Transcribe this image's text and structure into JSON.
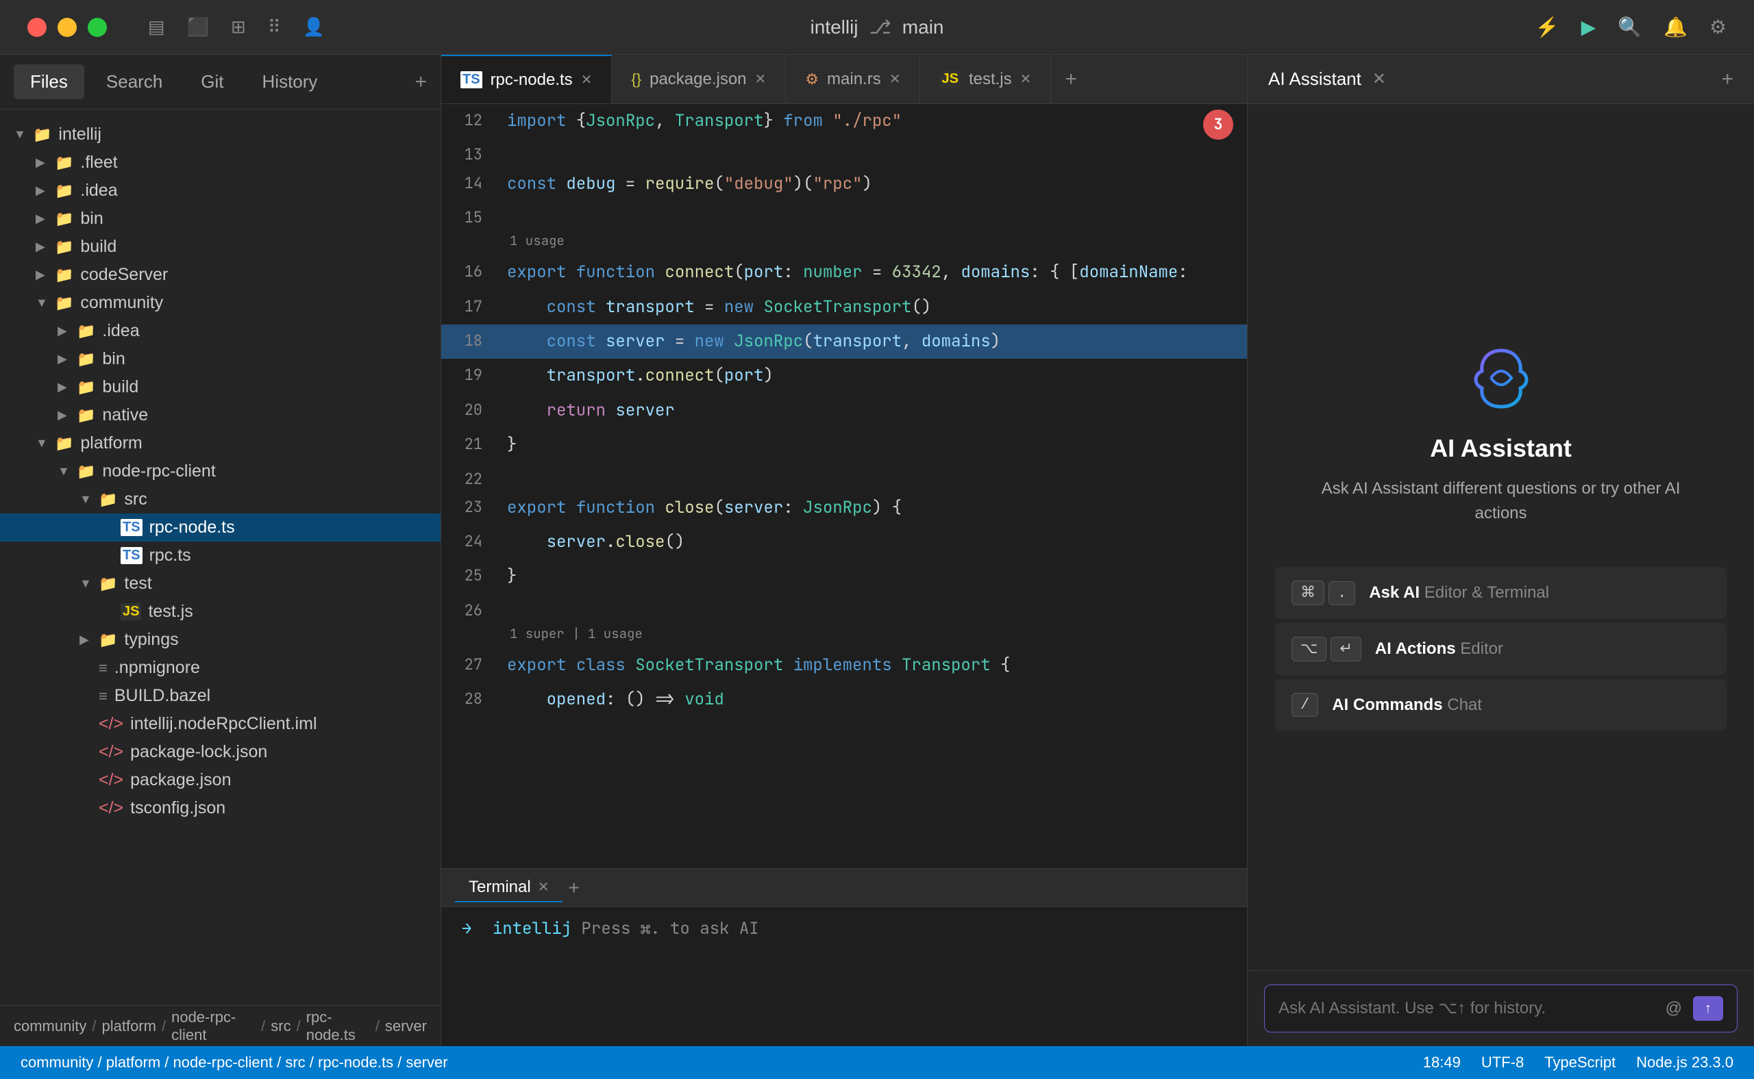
{
  "titlebar": {
    "app_name": "intellij",
    "branch": "main",
    "icons": [
      "sidebar-left",
      "sidebar-bottom",
      "layout",
      "grid",
      "people"
    ]
  },
  "sidebar": {
    "tabs": [
      "Files",
      "Search",
      "Git",
      "History"
    ],
    "active_tab": "Files",
    "root_label": "intellij",
    "tree": [
      {
        "label": ".fleet",
        "type": "folder",
        "depth": 0,
        "collapsed": true
      },
      {
        "label": ".idea",
        "type": "folder",
        "depth": 0,
        "collapsed": true
      },
      {
        "label": "bin",
        "type": "folder",
        "depth": 0,
        "collapsed": true
      },
      {
        "label": "build",
        "type": "folder",
        "depth": 0,
        "collapsed": true
      },
      {
        "label": "codeServer",
        "type": "folder",
        "depth": 0,
        "collapsed": true
      },
      {
        "label": "community",
        "type": "folder",
        "depth": 0,
        "expanded": true
      },
      {
        "label": ".idea",
        "type": "folder",
        "depth": 1,
        "collapsed": true
      },
      {
        "label": "bin",
        "type": "folder",
        "depth": 1,
        "collapsed": true
      },
      {
        "label": "build",
        "type": "folder",
        "depth": 1,
        "collapsed": true
      },
      {
        "label": "native",
        "type": "folder",
        "depth": 1,
        "collapsed": true
      },
      {
        "label": "platform",
        "type": "folder",
        "depth": 0,
        "expanded": true
      },
      {
        "label": "node-rpc-client",
        "type": "folder",
        "depth": 1,
        "expanded": true
      },
      {
        "label": "src",
        "type": "folder",
        "depth": 2,
        "expanded": true
      },
      {
        "label": "rpc-node.ts",
        "type": "ts",
        "depth": 3,
        "selected": true
      },
      {
        "label": "rpc.ts",
        "type": "ts",
        "depth": 3
      },
      {
        "label": "test",
        "type": "folder",
        "depth": 2,
        "expanded": true
      },
      {
        "label": "test.js",
        "type": "js",
        "depth": 3
      },
      {
        "label": "typings",
        "type": "folder",
        "depth": 2,
        "collapsed": true
      },
      {
        "label": ".npmignore",
        "type": "file",
        "depth": 2
      },
      {
        "label": "BUILD.bazel",
        "type": "file",
        "depth": 2
      },
      {
        "label": "intellij.nodeRpcClient.iml",
        "type": "xml",
        "depth": 2
      },
      {
        "label": "package-lock.json",
        "type": "json",
        "depth": 2
      },
      {
        "label": "package.json",
        "type": "json",
        "depth": 2
      },
      {
        "label": "tsconfig.json",
        "type": "json",
        "depth": 2
      }
    ],
    "footer_breadcrumb": [
      "community",
      "platform",
      "node-rpc-client",
      "src",
      "rpc-node.ts",
      "server"
    ]
  },
  "editor": {
    "tabs": [
      {
        "label": "rpc-node.ts",
        "type": "ts",
        "active": true
      },
      {
        "label": "package.json",
        "type": "json",
        "active": false
      },
      {
        "label": "main.rs",
        "type": "rs",
        "active": false
      },
      {
        "label": "test.js",
        "type": "js",
        "active": false
      }
    ],
    "badge_count": "3",
    "lines": [
      {
        "num": "12",
        "meta": "",
        "content": "import {JsonRpc, Transport} from \"./rpc\""
      },
      {
        "num": "13",
        "meta": "",
        "content": ""
      },
      {
        "num": "14",
        "meta": "",
        "content": "const debug = require(\"debug\")(\"rpc\")"
      },
      {
        "num": "15",
        "meta": "",
        "content": ""
      },
      {
        "num": "16",
        "meta": "1 usage",
        "content": "export function connect(port: number = 63342, domains: { [domainName:"
      },
      {
        "num": "17",
        "meta": "",
        "content": "  const transport = new SocketTransport()"
      },
      {
        "num": "18",
        "meta": "",
        "content": "  const server = new JsonRpc(transport, domains)",
        "highlighted": true
      },
      {
        "num": "19",
        "meta": "",
        "content": "  transport.connect(port)"
      },
      {
        "num": "20",
        "meta": "",
        "content": "  return server"
      },
      {
        "num": "21",
        "meta": "",
        "content": "}"
      },
      {
        "num": "22",
        "meta": "",
        "content": ""
      },
      {
        "num": "23",
        "meta": "",
        "content": "export function close(server: JsonRpc) {"
      },
      {
        "num": "24",
        "meta": "",
        "content": "  server.close()"
      },
      {
        "num": "25",
        "meta": "",
        "content": "}"
      },
      {
        "num": "26",
        "meta": "",
        "content": ""
      },
      {
        "num": "27",
        "meta": "1 super | 1 usage",
        "content": "export class SocketTransport implements Transport {"
      },
      {
        "num": "28",
        "meta": "",
        "content": "  opened: () => void"
      }
    ]
  },
  "terminal": {
    "tabs": [
      "Terminal"
    ],
    "active_tab": "Terminal",
    "prompt_symbol": "→",
    "prompt_label": "intellij",
    "command": "Press ⌘. to ask AI"
  },
  "ai_panel": {
    "title": "AI Assistant",
    "logo_alt": "AI swirl logo",
    "welcome_title": "AI Assistant",
    "welcome_desc": "Ask AI Assistant different questions or try other AI actions",
    "actions": [
      {
        "keys": [
          "⌘",
          "."
        ],
        "label_bold": "Ask AI",
        "label_rest": "Editor & Terminal"
      },
      {
        "keys": [
          "⌥",
          "↵"
        ],
        "label_bold": "AI Actions",
        "label_rest": "Editor"
      },
      {
        "keys": [
          "/"
        ],
        "label_bold": "AI Commands",
        "label_rest": "Chat"
      }
    ],
    "input_placeholder": "Ask AI Assistant. Use ⌥↑ for history.",
    "input_at_label": "@",
    "input_send_label": "↑"
  },
  "status_bar": {
    "breadcrumb": [
      "community",
      "platform",
      "node-rpc-client",
      "src",
      "rpc-node.ts",
      "server"
    ],
    "time": "18:49",
    "encoding": "UTF-8",
    "language": "TypeScript",
    "runtime": "Node.js 23.3.0"
  }
}
